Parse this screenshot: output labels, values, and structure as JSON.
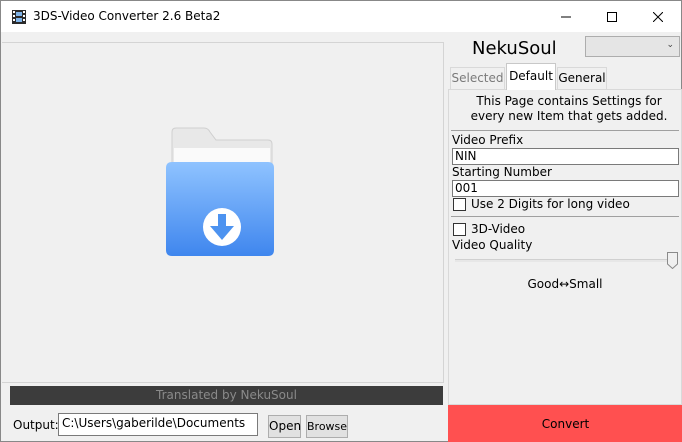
{
  "window": {
    "title": "3DS-Video Converter 2.6 Beta2"
  },
  "drop_area": {
    "icon": "folder-download-icon",
    "translated_by": "Translated by NekuSoul"
  },
  "output": {
    "label": "Output:",
    "path": "C:\\Users\\gaberilde\\Documents",
    "open_label": "Open",
    "browse_label": "Browse"
  },
  "profile": {
    "name": "NekuSoul",
    "selected_value": ""
  },
  "tabs": [
    {
      "label": "Selected",
      "active": false,
      "enabled": false
    },
    {
      "label": "Default",
      "active": true,
      "enabled": true
    },
    {
      "label": "General",
      "active": false,
      "enabled": true
    }
  ],
  "settings": {
    "info": "This Page contains Settings for every new Item that gets added.",
    "video_prefix_label": "Video Prefix",
    "video_prefix_value": "NIN",
    "starting_number_label": "Starting Number",
    "starting_number_value": "001",
    "two_digits_label": "Use 2 Digits for long video",
    "two_digits_checked": false,
    "three_d_label": "3D-Video",
    "three_d_checked": false,
    "quality_label": "Video Quality",
    "quality_level": 1.0,
    "quality_caption": "Good↔Small"
  },
  "convert": {
    "label": "Convert",
    "color": "#ff5050"
  }
}
